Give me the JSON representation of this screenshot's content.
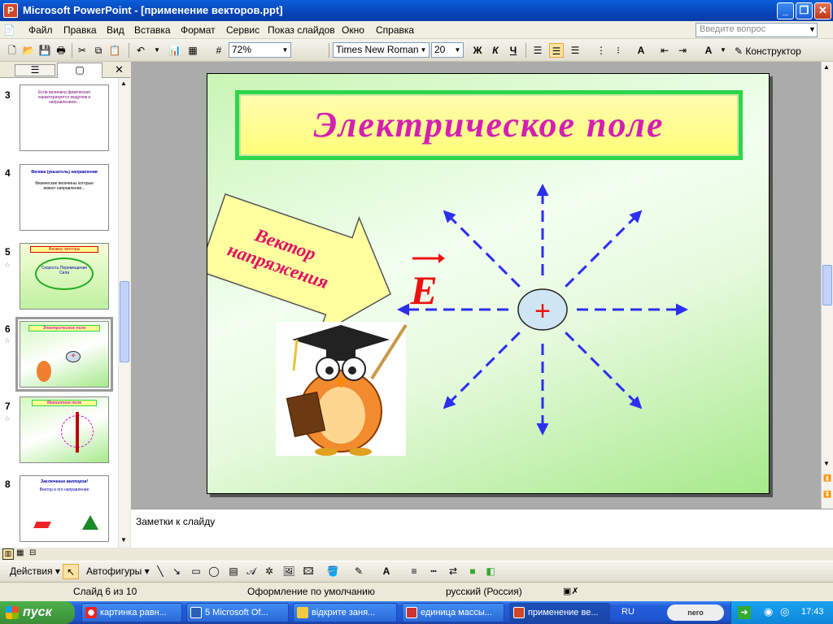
{
  "window": {
    "title": "Microsoft PowerPoint - [применение векторов.ppt]"
  },
  "menu": [
    "Файл",
    "Правка",
    "Вид",
    "Вставка",
    "Формат",
    "Сервис",
    "Показ слайдов",
    "Окно",
    "Справка"
  ],
  "help": {
    "placeholder": "Введите вопрос"
  },
  "toolbar": {
    "zoom": "72%",
    "font": "Times New Roman",
    "size": "20",
    "bold": "Ж",
    "italic": "К",
    "underline": "Ч",
    "designer": "Конструктор"
  },
  "thumbnails": [
    {
      "num": "3",
      "title": "",
      "text": "Если величина физическая характеризуется модулем и направлением..."
    },
    {
      "num": "4",
      "title": "Физика (указатель) направления",
      "text": "Физические величины которые имеют направление..."
    },
    {
      "num": "5",
      "title": "Физика: векторы",
      "text": "Скорость Перемещение Сила"
    },
    {
      "num": "6",
      "title": "Электрическое поле",
      "text": ""
    },
    {
      "num": "7",
      "title": "Магнитное поле",
      "text": ""
    },
    {
      "num": "8",
      "title": "Заключение векторов!",
      "text": "Вектор и его направление"
    }
  ],
  "slide": {
    "title": "Электрическое поле",
    "arrow_label": "Вектор напряжения",
    "vector_letter": "E",
    "charge_sign": "+"
  },
  "notes": {
    "label": "Заметки к слайду"
  },
  "drawbar": {
    "actions": "Действия",
    "autoshapes": "Автофигуры"
  },
  "status": {
    "slide": "Слайд 6 из 10",
    "design": "Оформление по умолчанию",
    "lang": "русский (Россия)"
  },
  "taskbar": {
    "start": "пуск",
    "tasks": [
      "картинка равн...",
      "5 Microsoft Of...",
      "відкрите заня...",
      "единица массы...",
      "применение ве..."
    ],
    "lang": "RU",
    "time": "17:43"
  },
  "colors": {
    "title": "#d41fb2",
    "arrows": "#2c2ef0",
    "vector": "#ee1111",
    "border": "#2dd64b"
  }
}
